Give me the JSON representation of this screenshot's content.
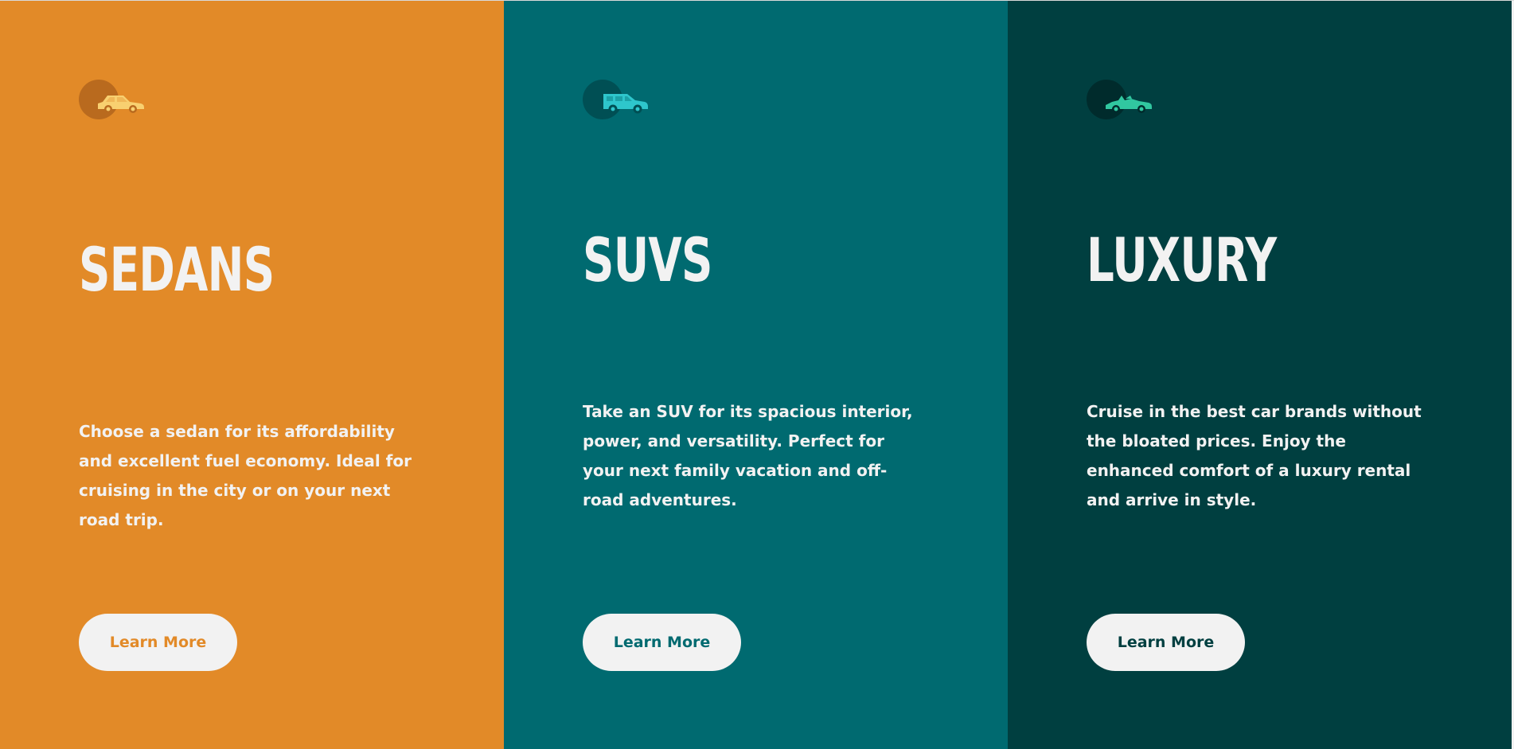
{
  "cards": [
    {
      "title": "SEDANS",
      "description": "Choose a sedan for its affordability and excellent fuel economy. Ideal for cruising in the city or on your next road trip.",
      "button_label": "Learn More",
      "icon": "sedan-icon",
      "background": "#e28a28",
      "accent": "#f8d070"
    },
    {
      "title": "SUVS",
      "description": "Take an SUV for its spacious interior, power, and versatility. Perfect for your next family vacation and off-road adventures.",
      "button_label": "Learn More",
      "icon": "suv-icon",
      "background": "#006a70",
      "accent": "#2ec6cc"
    },
    {
      "title": "LUXURY",
      "description": "Cruise in the best car brands without the bloated prices. Enjoy the enhanced comfort of a luxury rental and arrive in style.",
      "button_label": "Learn More",
      "icon": "luxury-car-icon",
      "background": "#003f40",
      "accent": "#31c7a0"
    }
  ]
}
